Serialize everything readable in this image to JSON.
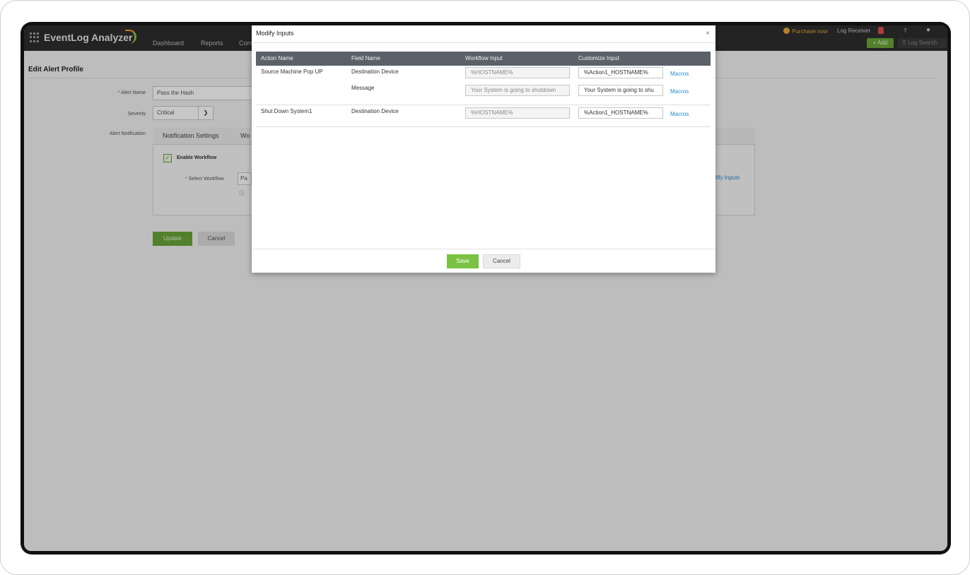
{
  "app": {
    "name": "EventLog Analyzer",
    "nav": [
      "Dashboard",
      "Reports",
      "Com"
    ],
    "top_right": {
      "purchase": "Purchase now",
      "log_receiver": "Log Receiver",
      "help": "?",
      "add": "+ Add",
      "log_search": "Log Search"
    }
  },
  "page": {
    "title": "Edit Alert Profile",
    "alert_name_label": "Alert Name",
    "alert_name_value": "Pass the Hash",
    "severity_label": "Severity",
    "severity_value": "Critical",
    "alert_notification_label": "Alert Notification",
    "tabs": [
      "Notification Settings",
      "Wo"
    ],
    "enable_workflow": "Enable Workflow",
    "select_workflow_label": "Select Workflow",
    "select_workflow_value": "Pa",
    "modify_inputs_link": "dify Inputs",
    "update": "Update",
    "cancel": "Cancel"
  },
  "modal": {
    "title": "Modify Inputs",
    "close": "×",
    "columns": [
      "Action Name",
      "Field Name",
      "Workflow Input",
      "Customize Input"
    ],
    "rows": [
      {
        "action": "Source Machine Pop UP",
        "field": "Destination Device",
        "workflow_input": "%HOSTNAME%",
        "customize_input": "%Action1_HOSTNAME%",
        "link": "Macros"
      },
      {
        "action": "",
        "field": "Message",
        "workflow_input": "Your System is going to shutdown",
        "customize_input": "Your System is going to shu",
        "link": "Macros"
      },
      {
        "action": "Shut Down System1",
        "field": "Destination Device",
        "workflow_input": "%HOSTNAME%",
        "customize_input": "%Action1_HOSTNAME%",
        "link": "Macros"
      }
    ],
    "save": "Save",
    "cancel": "Cancel"
  }
}
